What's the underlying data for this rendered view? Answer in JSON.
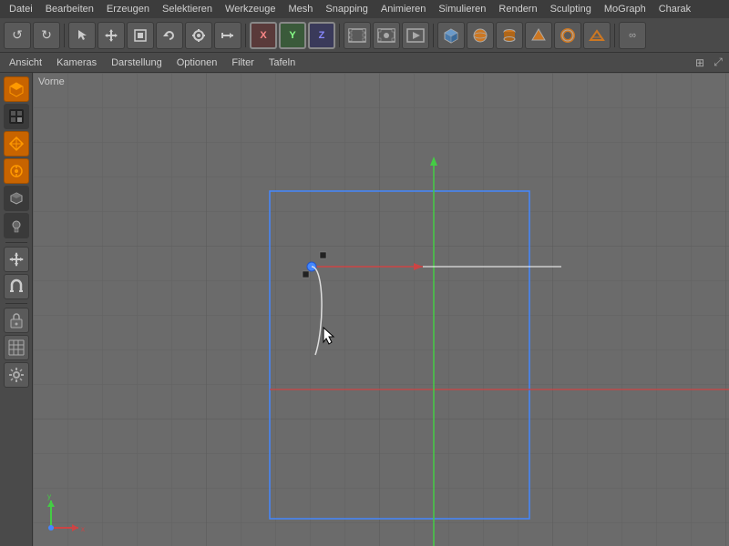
{
  "menubar": {
    "items": [
      "Datei",
      "Bearbeiten",
      "Erzeugen",
      "Selektieren",
      "Werkzeuge",
      "Mesh",
      "Snapping",
      "Animieren",
      "Simulieren",
      "Rendern",
      "Sculpting",
      "MoGraph",
      "Charak"
    ]
  },
  "subtoolbar": {
    "items": [
      "Ansicht",
      "Kameras",
      "Darstellung",
      "Optionen",
      "Filter",
      "Tafeln"
    ]
  },
  "viewport": {
    "label": "Vorne"
  },
  "toolbar": {
    "groups": [
      {
        "icons": [
          "↺",
          "↻"
        ]
      },
      {
        "icons": [
          "⊙",
          "✛",
          "□",
          "↺",
          "◎",
          "←→",
          "↑↓",
          "↗"
        ]
      },
      {
        "icons": [
          "X",
          "Y",
          "Z"
        ]
      },
      {
        "icons": [
          "⊡",
          "⊞",
          "⊟",
          "⊠"
        ]
      },
      {
        "icons": [
          "●",
          "◎",
          "⬡",
          "✦",
          "⬟",
          "□"
        ]
      },
      {
        "icons": [
          "∞"
        ]
      }
    ]
  },
  "sidebar": {
    "buttons": [
      {
        "icon": "◻",
        "orange": true
      },
      {
        "icon": "◼",
        "orange": false
      },
      {
        "icon": "⬡",
        "orange": true
      },
      {
        "icon": "◉",
        "orange": true
      },
      {
        "icon": "⬢",
        "orange": false
      },
      {
        "icon": "◧",
        "orange": false
      },
      {
        "sep": true
      },
      {
        "icon": "⊕",
        "orange": false
      },
      {
        "icon": "⊘",
        "orange": false
      },
      {
        "icon": "⊖",
        "orange": false
      },
      {
        "sep": true
      },
      {
        "icon": "⬛",
        "orange": false
      },
      {
        "icon": "⊞",
        "orange": false
      }
    ]
  }
}
